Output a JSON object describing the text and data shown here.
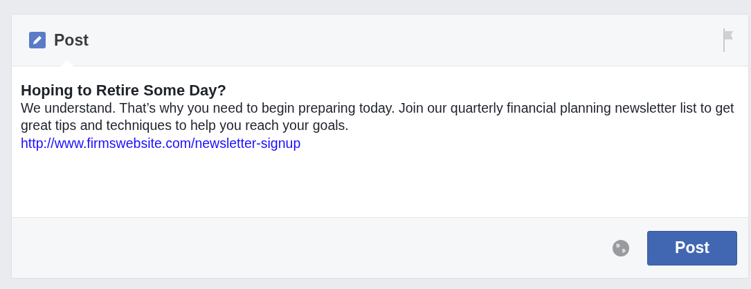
{
  "tabs": [
    {
      "label": "Post",
      "selected": true
    }
  ],
  "post": {
    "title": "Hoping to Retire Some Day?",
    "body": "We understand. That’s why you need to begin preparing today. Join our quarterly financial planning newsletter list to get great tips and techniques to help you reach your goals.",
    "link": "http://www.firmswebsite.com/newsletter-signup"
  },
  "buttons": [
    "Post"
  ]
}
